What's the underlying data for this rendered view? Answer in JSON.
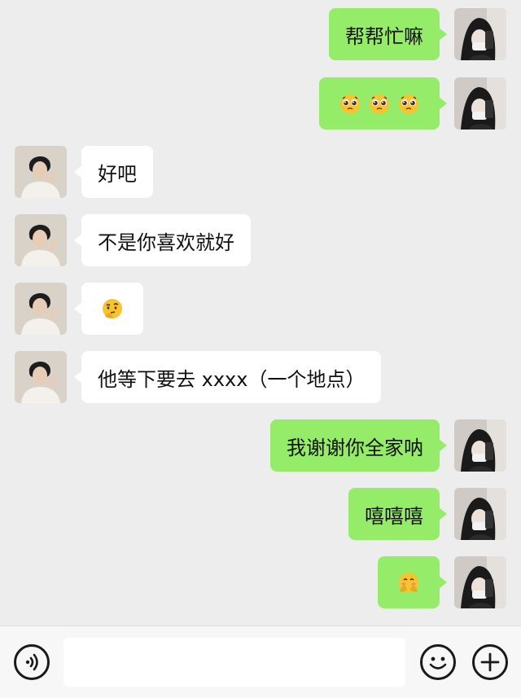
{
  "messages": [
    {
      "sender": "me",
      "text": "帮帮忙嘛"
    },
    {
      "sender": "me",
      "emoji": "pleading-face-icon",
      "emoji_count": 3
    },
    {
      "sender": "other",
      "text": "好吧"
    },
    {
      "sender": "other",
      "text": "不是你喜欢就好"
    },
    {
      "sender": "other",
      "emoji": "thinking-face-icon",
      "emoji_count": 1
    },
    {
      "sender": "other",
      "text": "他等下要去 xxxx（一个地点）"
    },
    {
      "sender": "me",
      "text": "我谢谢你全家呐"
    },
    {
      "sender": "me",
      "text": "嘻嘻嘻"
    },
    {
      "sender": "me",
      "emoji": "shy-giggle-face-icon",
      "emoji_count": 1
    }
  ],
  "input_bar": {
    "placeholder": "",
    "voice_icon": "voice-icon",
    "emoji_icon": "emoji-icon",
    "add_icon": "plus-icon"
  },
  "colors": {
    "background": "#ededed",
    "my_bubble": "#95ec69",
    "other_bubble": "#ffffff",
    "emoji_yellow": "#f6c431"
  }
}
